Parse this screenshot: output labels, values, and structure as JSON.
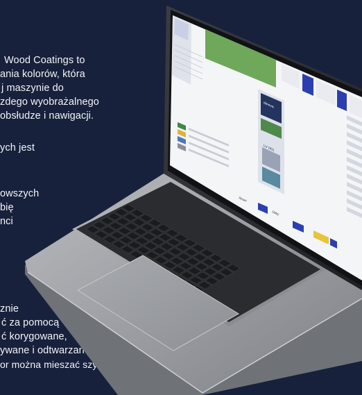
{
  "paragraph1": [
    "Wood Coatings to",
    "ania kolorów, która",
    "j maszynie do",
    "zdego wyobrażalnego",
    "obsłudze i nawigacji."
  ],
  "paragraph2": [
    "ych jest"
  ],
  "paragraph3": [
    "owszych",
    "bię",
    "nci"
  ],
  "paragraph4": [
    "znie",
    "ć za pomocą",
    "ć korygowane,",
    "ywane i odtwarzane",
    "or można mieszać szybko"
  ],
  "screen": {
    "brand_label": "dinova",
    "product_code": "LV 001",
    "button_labels": [
      "Reset",
      "Dalej"
    ],
    "colors": {
      "accent_green": "#6fa85a",
      "accent_blue": "#2b3fb0",
      "accent_yellow": "#e8c43a",
      "card_navy": "#23345e",
      "card_green": "#4f8a4a"
    }
  },
  "colors": {
    "background": "#17213b",
    "laptop_body": "#9b9ea2",
    "keyboard": "#2a2c2f"
  }
}
